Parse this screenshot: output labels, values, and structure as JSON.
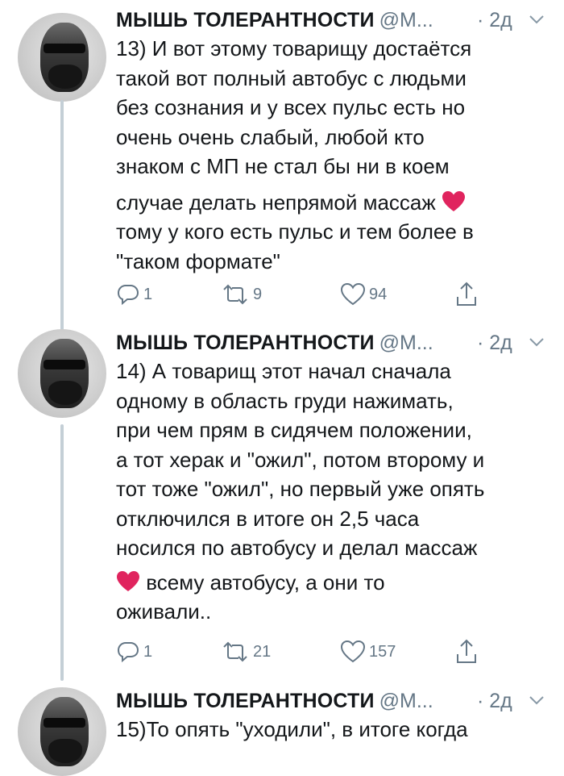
{
  "tweets": [
    {
      "name": "МЫШЬ ТОЛЕРАНТНОСТИ",
      "handle": "@М...",
      "time": "· 2д",
      "lines": [
        "13) И вот этому товарищу достаётся",
        "такой вот полный автобус с людьми",
        "без сознания и у всех пульс есть но",
        "очень очень слабый, любой кто",
        "знаком с МП не стал бы ни в коем",
        "случае делать непрямой массаж ",
        "тому у кого есть пульс и тем более в",
        "\"таком формате\""
      ],
      "replies": "1",
      "retweets": "9",
      "likes": "94"
    },
    {
      "name": "МЫШЬ ТОЛЕРАНТНОСТИ",
      "handle": "@М...",
      "time": "· 2д",
      "lines": [
        "14) А товарищ этот начал сначала",
        "одному в область груди нажимать,",
        "при чем прям в сидячем положении,",
        "а тот херак и \"ожил\", потом второму и",
        "тот тоже \"ожил\", но первый уже опять",
        "отключился в итоге он 2,5 часа",
        "носился по автобусу и делал массаж",
        " всему автобусу, а они то",
        "оживали.."
      ],
      "replies": "1",
      "retweets": "21",
      "likes": "157"
    },
    {
      "name": "МЫШЬ ТОЛЕРАНТНОСТИ",
      "handle": "@М...",
      "time": "· 2д",
      "lines": [
        "15)То опять \"уходили\", в итоге когда"
      ]
    }
  ],
  "icons": {
    "reply": "reply-icon",
    "retweet": "retweet-icon",
    "like": "heart-outline-icon",
    "share": "share-icon",
    "menu": "chevron-down-icon",
    "emoji": "red-heart-emoji"
  },
  "colors": {
    "text": "#14171a",
    "secondary": "#657786",
    "thread": "#c4cfd6",
    "emoji": "#e0245e"
  }
}
